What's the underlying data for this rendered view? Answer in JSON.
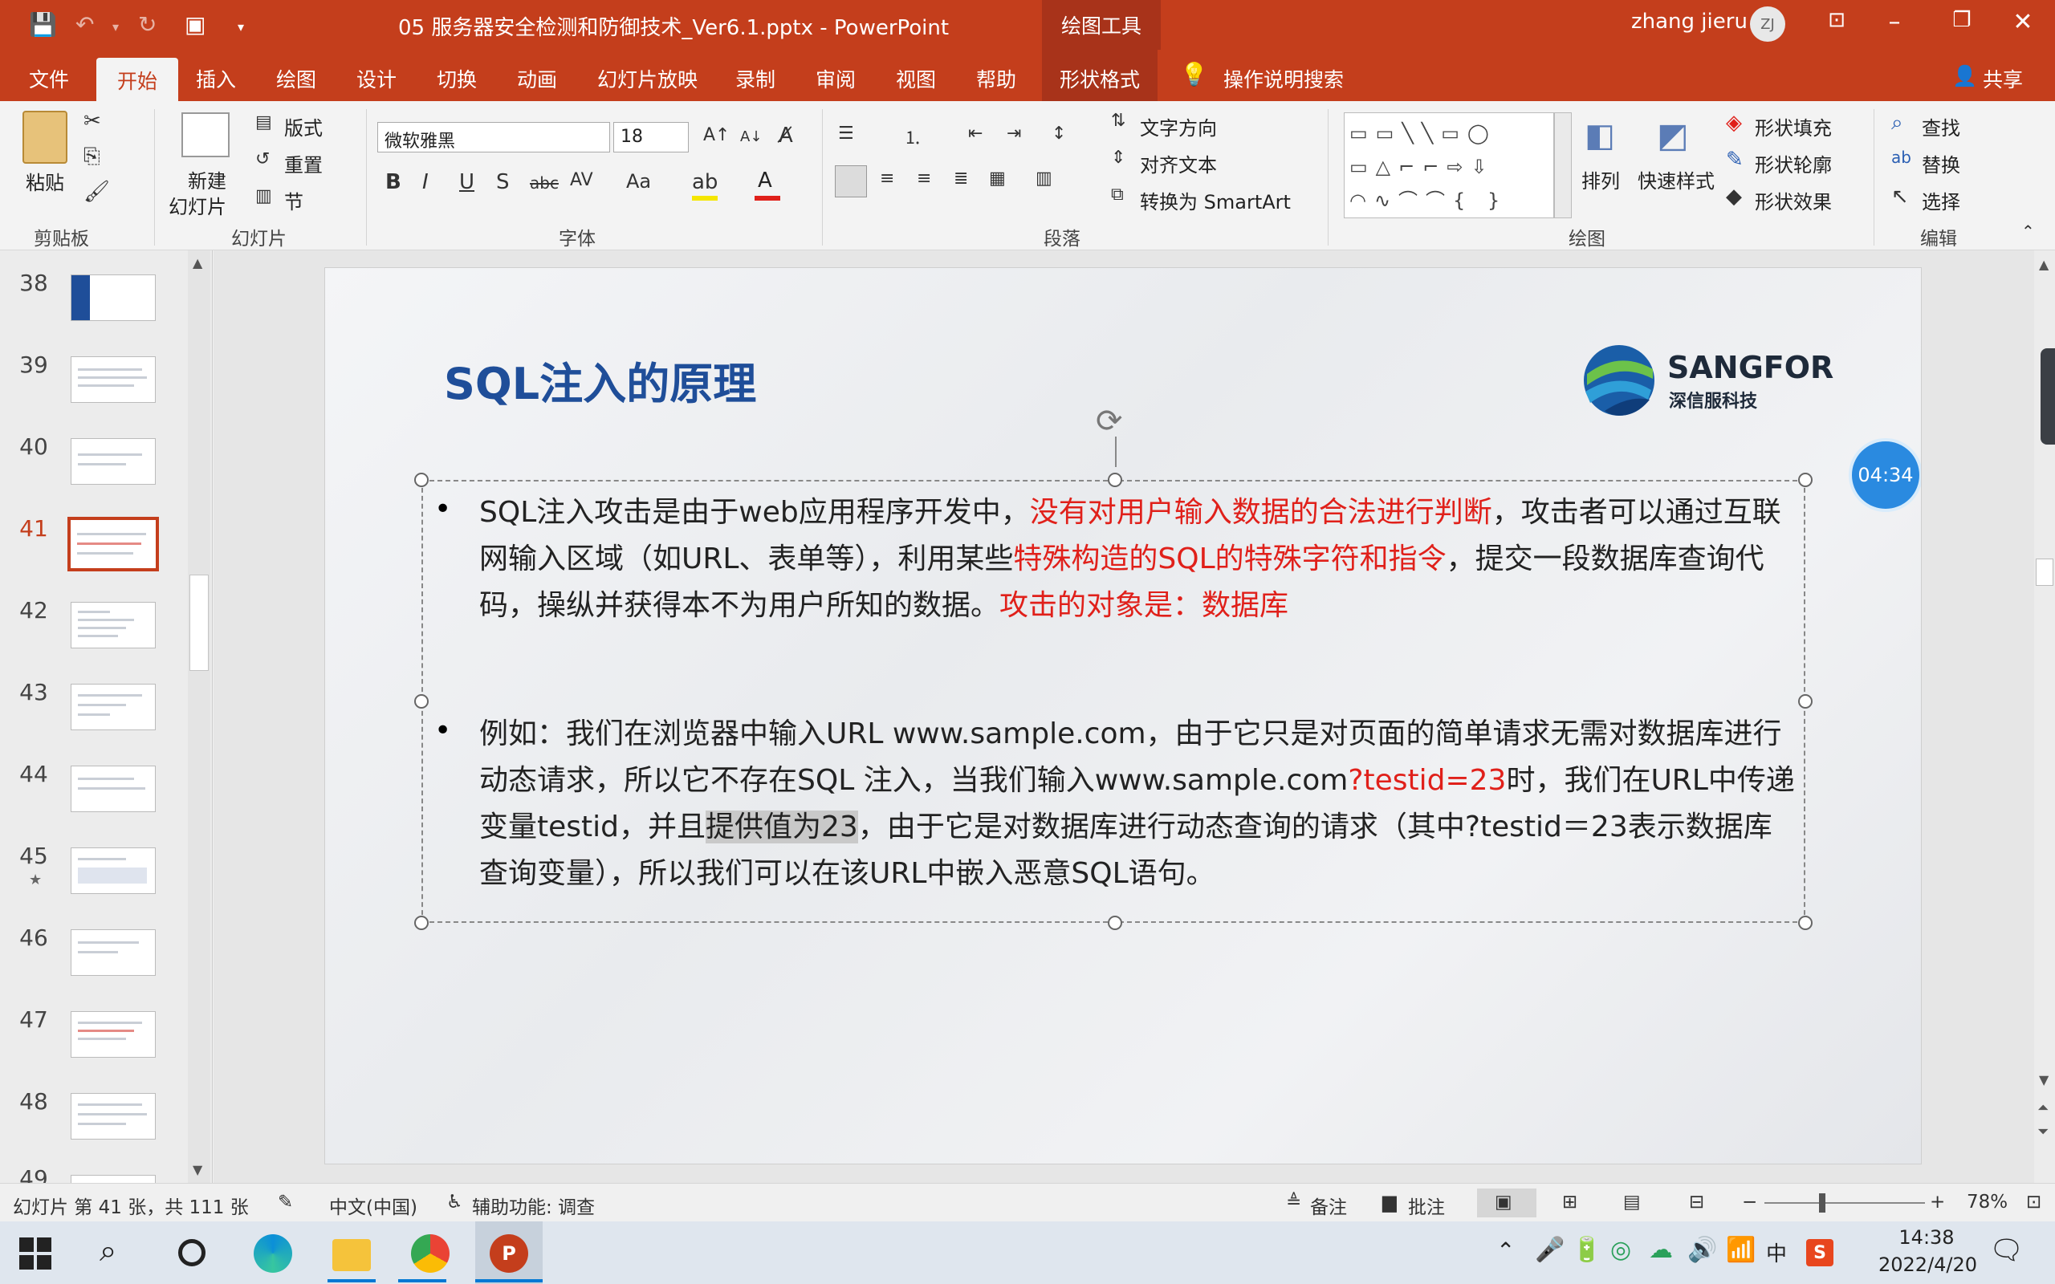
{
  "window": {
    "title": "05 服务器安全检测和防御技术_Ver6.1.pptx  -  PowerPoint",
    "context_group": "绘图工具",
    "user_name": "zhang jieru",
    "user_initials": "ZJ"
  },
  "tabs": [
    "文件",
    "开始",
    "插入",
    "绘图",
    "设计",
    "切换",
    "动画",
    "幻灯片放映",
    "录制",
    "审阅",
    "视图",
    "帮助",
    "形状格式"
  ],
  "tell_me": "操作说明搜索",
  "share": "共享",
  "ribbon": {
    "clipboard": {
      "label": "剪贴板",
      "paste": "粘贴"
    },
    "slides": {
      "label": "幻灯片",
      "new_slide_1": "新建",
      "new_slide_2": "幻灯片",
      "layout": "版式",
      "reset": "重置",
      "section": "节"
    },
    "font": {
      "label": "字体",
      "font_name": "微软雅黑",
      "font_size": "18"
    },
    "paragraph": {
      "label": "段落",
      "text_direction": "文字方向",
      "align_text": "对齐文本",
      "smartart": "转换为 SmartArt"
    },
    "drawing": {
      "label": "绘图",
      "arrange": "排列",
      "quick_styles": "快速样式",
      "shape_fill": "形状填充",
      "shape_outline": "形状轮廓",
      "shape_effects": "形状效果"
    },
    "editing": {
      "label": "编辑",
      "find": "查找",
      "replace": "替换",
      "select": "选择"
    }
  },
  "thumbnails": [
    "38",
    "39",
    "40",
    "41",
    "42",
    "43",
    "44",
    "45",
    "46",
    "47",
    "48",
    "49"
  ],
  "selected_slide": "41",
  "slide": {
    "title": "SQL注入的原理",
    "logo_name": "SANGFOR",
    "logo_sub": "深信服科技",
    "timer": "04:34",
    "p1": {
      "a": "SQL注入攻击是由于web应用程序开发中，",
      "b": "没有对用户输入数据的合法进行判断",
      "c": "，攻击者可以通过互联网输入区域（如URL、表单等），利用某些",
      "d": "特殊构造的SQL的特殊字符和指令",
      "e": "，提交一段数据库查询代码，操纵并获得本不为用户所知的数据。",
      "f": "攻击的对象是：数据库"
    },
    "p2": {
      "a": "例如：我们在浏览器中输入URL www.sample.com，由于它只是对页面的简单请求无需对数据库进行动态请求，所以它不存在SQL 注入，当我们输入www.sample.com",
      "b": "?testid=23",
      "c": "时，我们在URL中传递变量testid，并且",
      "d": "提供值为23",
      "e": "，由于它是对数据库进行动态查询的请求（其中?testid＝23表示数据库查询变量），所以我们可以在该URL中嵌入恶意SQL语句。"
    }
  },
  "status": {
    "slide_info": "幻灯片 第 41 张，共 111 张",
    "language": "中文(中国)",
    "accessibility": "辅助功能: 调查",
    "notes": "备注",
    "comments": "批注",
    "zoom": "78%"
  },
  "taskbar": {
    "time": "14:38",
    "date": "2022/4/20",
    "ime": "中"
  },
  "colors": {
    "accent": "#c43e1c",
    "title_blue": "#1f4e99",
    "emphasis_red": "#e0201a"
  }
}
